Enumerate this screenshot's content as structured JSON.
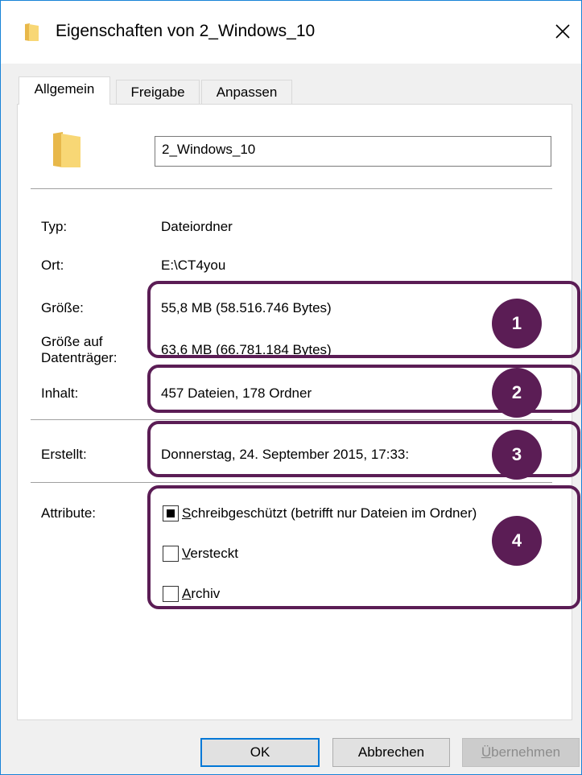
{
  "window": {
    "title": "Eigenschaften von 2_Windows_10"
  },
  "tabs": [
    {
      "label": "Allgemein",
      "active": true
    },
    {
      "label": "Freigabe",
      "active": false
    },
    {
      "label": "Anpassen",
      "active": false
    }
  ],
  "general": {
    "name_value": "2_Windows_10",
    "fields": {
      "type": {
        "label": "Typ:",
        "value": "Dateiordner"
      },
      "location": {
        "label": "Ort:",
        "value": "E:\\CT4you"
      },
      "size": {
        "label": "Größe:",
        "value": "55,8 MB (58.516.746 Bytes)"
      },
      "size_on_disk": {
        "label_line1": "Größe auf",
        "label_line2": "Datenträger:",
        "value": "63,6 MB (66.781.184 Bytes)"
      },
      "contents": {
        "label": "Inhalt:",
        "value": "457 Dateien, 178 Ordner"
      },
      "created": {
        "label": "Erstellt:",
        "value": "Donnerstag, 24. September 2015, 17:33:"
      }
    },
    "attributes": {
      "label": "Attribute:",
      "items": [
        {
          "accel": "S",
          "rest": "chreibgeschützt (betrifft nur Dateien im Ordner)",
          "state": "indeterminate"
        },
        {
          "accel": "V",
          "rest": "ersteckt",
          "state": "unchecked"
        },
        {
          "accel": "A",
          "rest": "rchiv",
          "state": "unchecked"
        }
      ]
    }
  },
  "buttons": {
    "ok": "OK",
    "cancel": "Abbrechen",
    "apply_accel": "Ü",
    "apply_rest": "bernehmen"
  },
  "annotations": {
    "badge1": "1",
    "badge2": "2",
    "badge3": "3",
    "badge4": "4",
    "color": "#5b1d55"
  },
  "colors": {
    "folder": "#f8d775",
    "folder_dark": "#e8b84a",
    "window_border": "#1883d7",
    "primary_button_border": "#0078d7"
  }
}
